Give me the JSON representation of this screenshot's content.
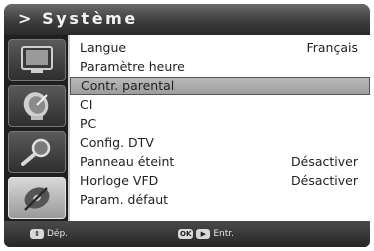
{
  "title": "> Système",
  "sidebar": {
    "icons": [
      {
        "name": "tv-screen-icon"
      },
      {
        "name": "satellite-dish-icon"
      },
      {
        "name": "magnifier-icon"
      },
      {
        "name": "disc-tools-icon"
      }
    ]
  },
  "menu": {
    "items": [
      {
        "label": "Langue",
        "value": "Français"
      },
      {
        "label": "Paramètre heure",
        "value": ""
      },
      {
        "label": "Contr. parental",
        "value": "",
        "selected": true
      },
      {
        "label": "CI",
        "value": ""
      },
      {
        "label": "PC",
        "value": ""
      },
      {
        "label": "Config. DTV",
        "value": ""
      },
      {
        "label": "Panneau éteint",
        "value": "Désactiver"
      },
      {
        "label": "Horloge VFD",
        "value": "Désactiver"
      },
      {
        "label": "Param. défaut",
        "value": ""
      }
    ]
  },
  "footer": {
    "move_label": "Dép.",
    "ok_key": "OK",
    "enter_label": "Entr."
  },
  "colors": {
    "title_bar": "#3d3d3d",
    "selection": "#a9a9a9",
    "list_bg": "#ffffff"
  }
}
